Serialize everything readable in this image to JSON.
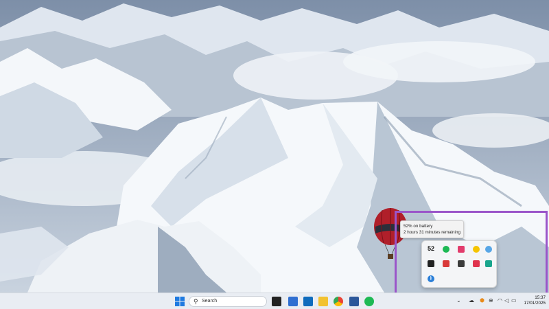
{
  "desktop": {
    "wallpaper": "snowy mountains aerial view"
  },
  "tooltip": {
    "line1": "52% on battery",
    "line2": "2 hours 31 minutes remaining"
  },
  "flyout": {
    "badge_number": "52"
  },
  "taskbar": {
    "search_placeholder": "Search",
    "clock_time": "15:37",
    "clock_date": "17/01/2025"
  },
  "colors": {
    "highlight": "#9a55c9",
    "taskbar_bg": "#e9edf3"
  }
}
